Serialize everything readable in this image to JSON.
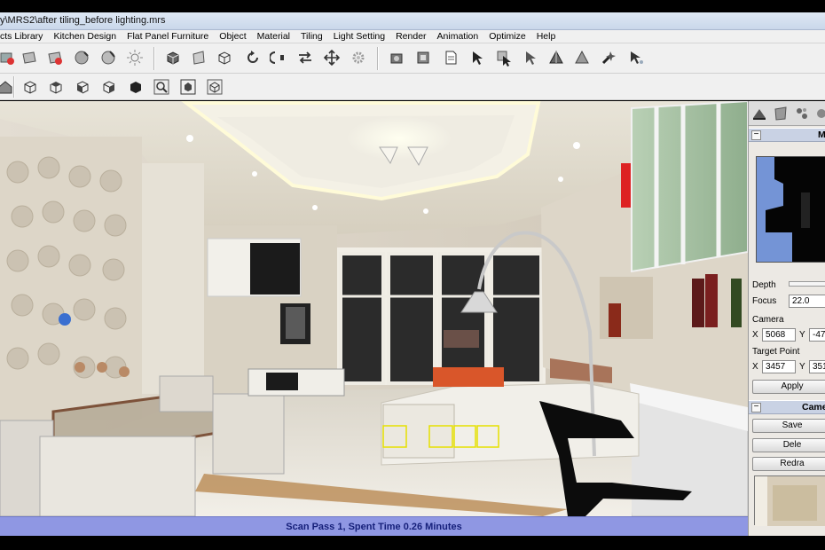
{
  "window": {
    "title": "y\\MRS2\\after tiling_before lighting.mrs"
  },
  "menu": [
    "cts Library",
    "Kitchen Design",
    "Flat Panel Furniture",
    "Object",
    "Material",
    "Tiling",
    "Light Setting",
    "Render",
    "Animation",
    "Optimize",
    "Help"
  ],
  "status": {
    "text": "Scan Pass 1, Spent Time 0.26 Minutes"
  },
  "panel": {
    "section1_title": "M",
    "depth_label": "Depth",
    "focus_label": "Focus",
    "focus_value": "22.0",
    "camera_label": "Camera",
    "camera_x_label": "X",
    "camera_x_value": "5068",
    "camera_y_label": "Y",
    "camera_y_value": "-47",
    "target_label": "Target Point",
    "target_x_label": "X",
    "target_x_value": "3457",
    "target_y_label": "Y",
    "target_y_value": "351",
    "apply_button": "Apply",
    "section2_title": "Came",
    "save_button": "Save",
    "delete_button": "Dele",
    "redraw_button": "Redra"
  },
  "colors": {
    "status_bar": "#8f97e3",
    "panel_header": "#c9d2e4",
    "toolbar": "#f0f0f0"
  }
}
